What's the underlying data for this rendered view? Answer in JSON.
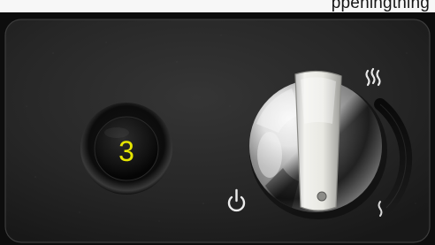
{
  "top_caption": "ppeningthing",
  "panel": {
    "surface_color": "#2a2a2a",
    "heat_level_display": {
      "value": "3",
      "digit_color": "#e6e600"
    },
    "power_symbol": "power-icon",
    "heat_high_symbol": "heat-waves-icon",
    "heat_low_symbol": "single-heat-wave-icon"
  }
}
